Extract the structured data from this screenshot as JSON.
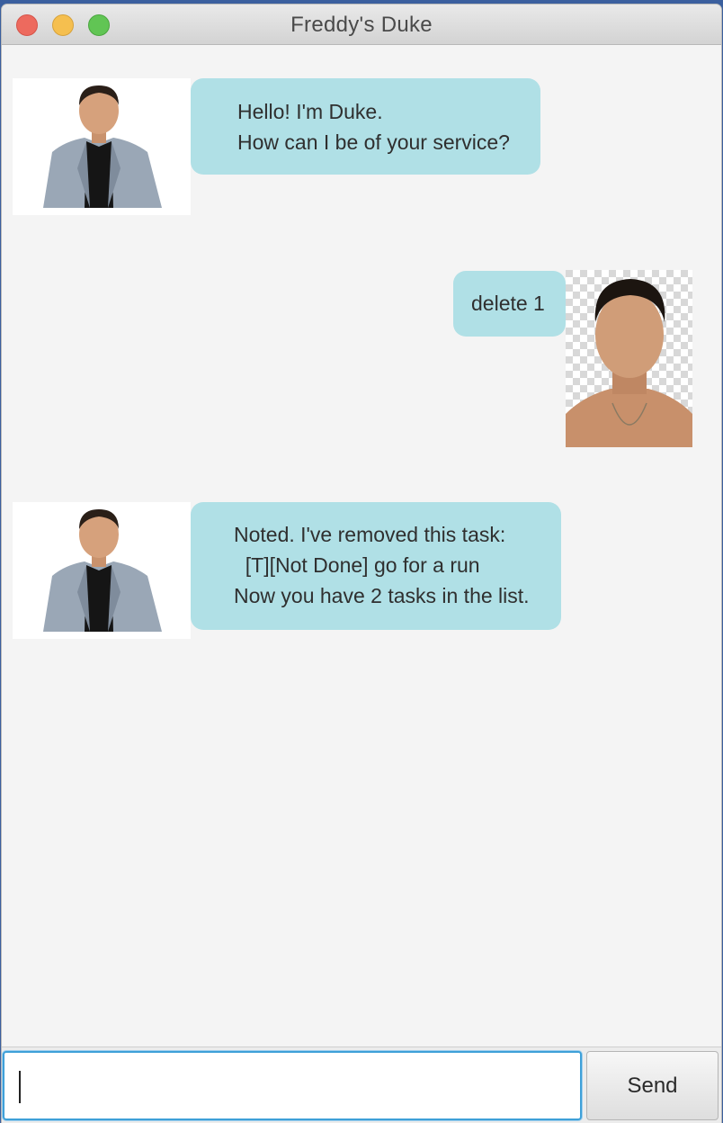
{
  "window": {
    "title": "Freddy's Duke"
  },
  "conversation": [
    {
      "speaker": "duke",
      "avatar_icon": "duke-avatar",
      "lines": [
        "Hello! I'm Duke.",
        "How can I be of your service?"
      ]
    },
    {
      "speaker": "user",
      "avatar_icon": "user-avatar",
      "lines": [
        "delete 1"
      ]
    },
    {
      "speaker": "duke",
      "avatar_icon": "duke-avatar",
      "lines": [
        "Noted. I've removed this task:",
        "  [T][Not Done] go for a run",
        "Now you have 2 tasks in the list."
      ]
    }
  ],
  "input": {
    "value": "",
    "placeholder": ""
  },
  "send_button": {
    "label": "Send"
  },
  "colors": {
    "bubble": "#b0e0e6",
    "background": "#f4f4f4",
    "focus_border": "#3ea0d8"
  }
}
